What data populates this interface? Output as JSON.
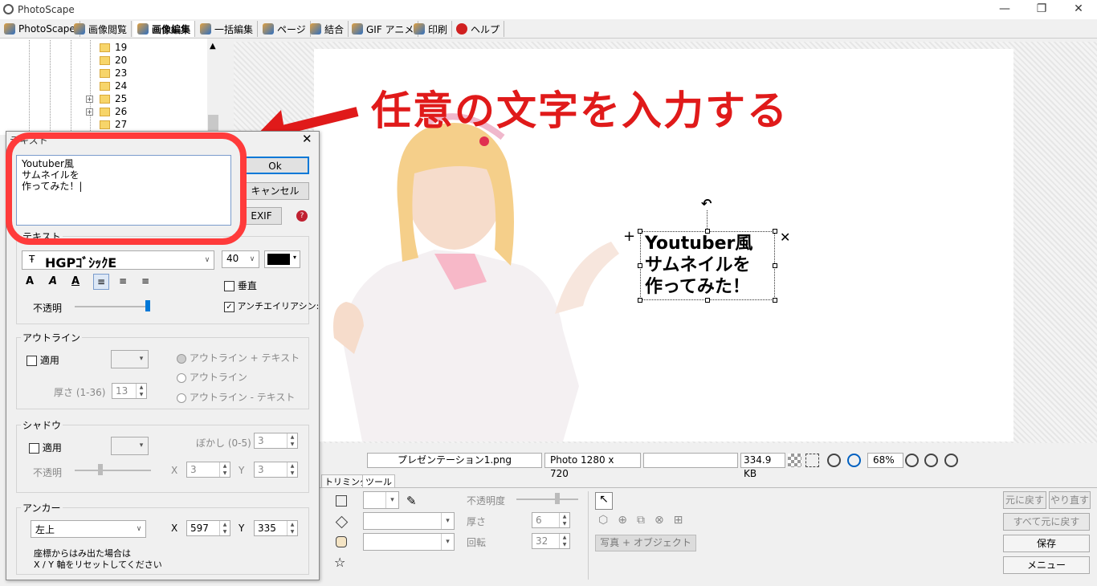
{
  "app": {
    "title": "PhotoScape"
  },
  "tabs": [
    "PhotoScape",
    "画像閲覧",
    "画像編集",
    "一括編集",
    "ページ",
    "結合",
    "GIF アニメ",
    "印刷",
    "ヘルプ"
  ],
  "tree": {
    "nodes": [
      "19",
      "20",
      "23",
      "24",
      "25",
      "26",
      "27"
    ]
  },
  "annotation": {
    "text": "任意の文字を入力する"
  },
  "canvas": {
    "text": "Youtuber風\nサムネイルを\n作ってみた！"
  },
  "statusbar": {
    "filename": "プレゼンテーション1.png",
    "dims": "Photo 1280 x 720",
    "size": "334.9 KB",
    "zoom": "68%"
  },
  "bottom_tabs": [
    "トリミング",
    "ツール"
  ],
  "tools": {
    "opacity_label": "不透明度",
    "thickness_label": "厚さ",
    "thickness": "6",
    "rotate_label": "回転",
    "rotate": "32",
    "photo_object": "写真 + オブジェクト"
  },
  "right_buttons": {
    "undo": "元に戻す",
    "redo": "やり直す",
    "undo_all": "すべて元に戻す",
    "save": "保存",
    "menu": "メニュー"
  },
  "dialog": {
    "title": "テキスト",
    "text_value": "Youtuber風\nサムネイルを\n作ってみた！|",
    "ok": "Ok",
    "cancel": "キャンセル",
    "exif": "EXIF",
    "text_group": "テキスト",
    "font": "HGPｺﾞｼｯｸE",
    "size": "40",
    "vertical": "垂直",
    "opacity": "不透明",
    "antialias": "アンチエイリアシン:",
    "outline_group": "アウトライン",
    "apply": "適用",
    "thick_label": "厚さ (1-36)",
    "thick": "13",
    "opt1": "アウトライン + テキスト",
    "opt2": "アウトライン",
    "opt3": "アウトライン - テキスト",
    "shadow_group": "シャドウ",
    "shadow_apply": "適用",
    "blur_label": "ぼかし (0-5)",
    "blur": "3",
    "shadow_opacity": "不透明",
    "sx_label": "X",
    "sx": "3",
    "sy_label": "Y",
    "sy": "3",
    "anchor_group": "アンカー",
    "anchor": "左上",
    "ax_label": "X",
    "ax": "597",
    "ay_label": "Y",
    "ay": "335",
    "note1": "座標からはみ出た場合は",
    "note2": "X / Y 軸をリセットしてください"
  }
}
